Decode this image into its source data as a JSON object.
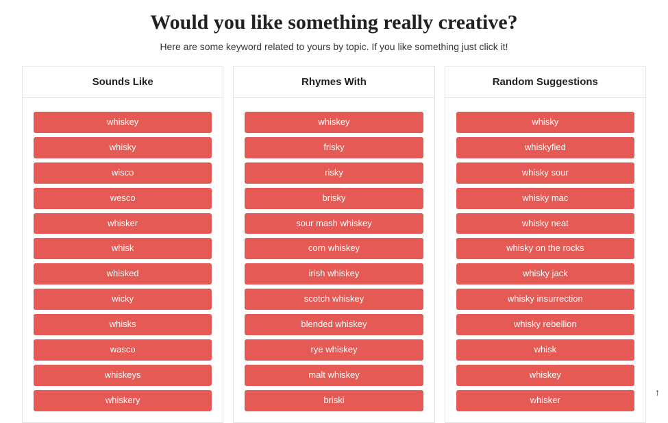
{
  "header": {
    "title": "Would you like something really creative?",
    "subtitle": "Here are some keyword related to yours by topic. If you like something just click it!"
  },
  "columns": [
    {
      "title": "Sounds Like",
      "items": [
        "whiskey",
        "whisky",
        "wisco",
        "wesco",
        "whisker",
        "whisk",
        "whisked",
        "wicky",
        "whisks",
        "wasco",
        "whiskeys",
        "whiskery"
      ]
    },
    {
      "title": "Rhymes With",
      "items": [
        "whiskey",
        "frisky",
        "risky",
        "brisky",
        "sour mash whiskey",
        "corn whiskey",
        "irish whiskey",
        "scotch whiskey",
        "blended whiskey",
        "rye whiskey",
        "malt whiskey",
        "briski"
      ]
    },
    {
      "title": "Random Suggestions",
      "items": [
        "whisky",
        "whiskyfied",
        "whisky sour",
        "whisky mac",
        "whisky neat",
        "whisky on the rocks",
        "whisky jack",
        "whisky insurrection",
        "whisky rebellion",
        "whisk",
        "whiskey",
        "whisker"
      ]
    }
  ],
  "scroll_top_icon": "↑"
}
